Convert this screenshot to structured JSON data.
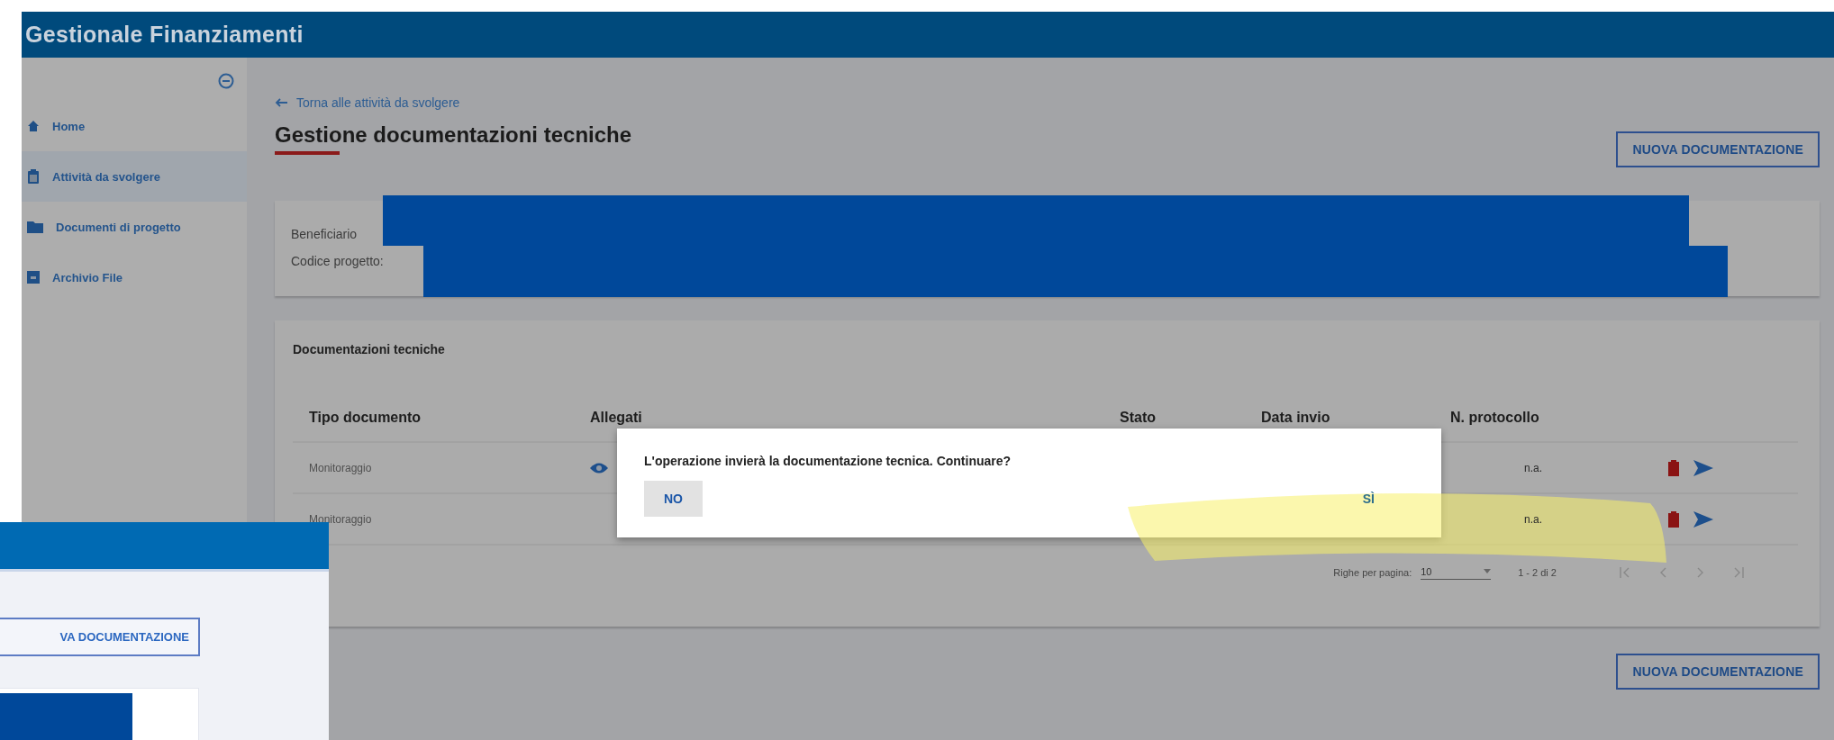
{
  "header": {
    "title": "Gestionale Finanziamenti"
  },
  "sidebar": {
    "items": [
      {
        "label": "Home",
        "kind": "home",
        "selected": false
      },
      {
        "label": "Attività  da svolgere",
        "kind": "tasks",
        "selected": true
      },
      {
        "label": "Documenti di progetto",
        "kind": "folder",
        "selected": false
      },
      {
        "label": "Archivio File",
        "kind": "archive",
        "selected": false
      }
    ]
  },
  "back_link": "Torna alle attività da svolgere",
  "page_title": "Gestione documentazioni tecniche",
  "top_button": "NUOVA DOCUMENTAZIONE",
  "project_info": {
    "fields": [
      "Beneficiario",
      "Codice progetto:"
    ]
  },
  "technical_docs": {
    "title": "Documentazioni tecniche",
    "columns": [
      "Tipo documento",
      "Allegati",
      "Stato",
      "Data invio",
      "N. protocollo"
    ],
    "rows": [
      {
        "type": "Monitoraggio",
        "has_attachment": true,
        "protocol": "n.a."
      },
      {
        "type": "Monitoraggio",
        "protocol": "n.a."
      }
    ],
    "pagination": {
      "rows_label": "Righe per pagina:",
      "rows_per_page": "10",
      "range": "1 - 2 di 2"
    }
  },
  "bottom_button": "NUOVA DOCUMENTAZIONE",
  "dialog": {
    "message": "L'operazione invierà la documentazione tecnica. Continuare?",
    "buttons": [
      {
        "label": "NO",
        "kind": "cancel"
      },
      {
        "label": "SÌ",
        "kind": "confirm"
      }
    ]
  },
  "inset": {
    "button": "VA DOCUMENTAZIONE"
  }
}
